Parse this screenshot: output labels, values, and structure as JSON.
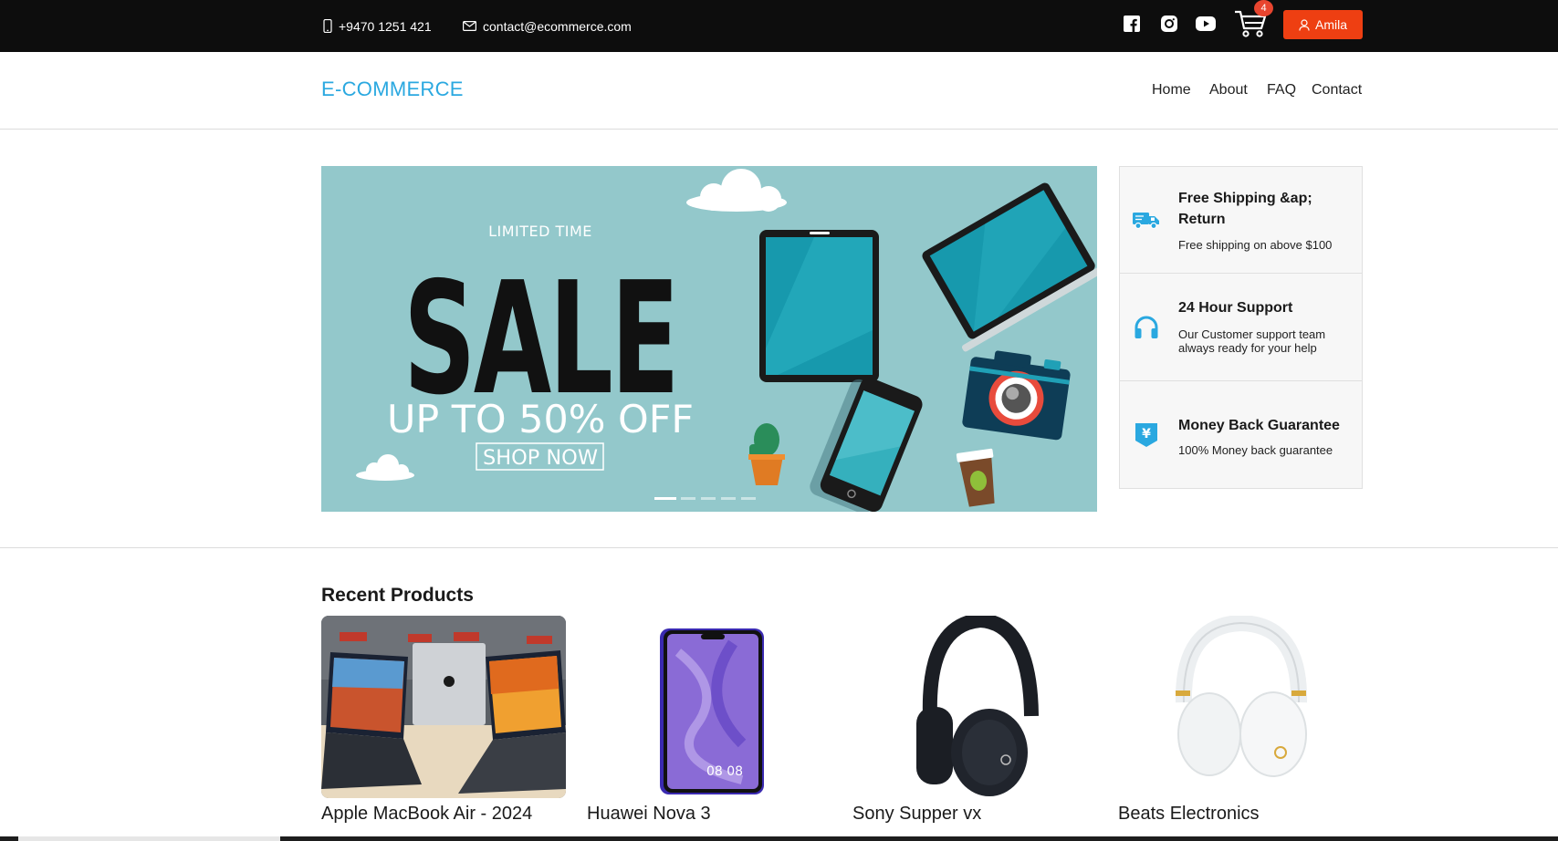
{
  "topbar": {
    "phone": "+9470 1251 421",
    "email": "contact@ecommerce.com",
    "social": [
      "facebook-icon",
      "instagram-icon",
      "youtube-icon"
    ],
    "cart_count": "4",
    "user_name": "Amila"
  },
  "nav": {
    "brand": "E-COMMERCE",
    "links": [
      "Home",
      "About",
      "FAQ",
      "Contact"
    ]
  },
  "banner": {
    "line1": "LIMITED TIME",
    "line2": "SALE",
    "line3": "UP TO 50% OFF",
    "cta": "SHOP NOW",
    "slides": 5,
    "active_slide": 1
  },
  "features": [
    {
      "icon": "truck-icon",
      "title": "Free Shipping &ap; Return",
      "desc": "Free shipping on above $100"
    },
    {
      "icon": "headphones-icon",
      "title": "24 Hour Support",
      "desc": "Our Customer support team always ready for your help"
    },
    {
      "icon": "money-back-icon",
      "title": "Money Back Guarantee",
      "desc": "100% Money back guarantee"
    }
  ],
  "recent": {
    "title": "Recent Products",
    "products": [
      {
        "name": "Apple MacBook Air - 2024"
      },
      {
        "name": "Huawei Nova 3"
      },
      {
        "name": "Sony Supper vx"
      },
      {
        "name": "Beats Electronics"
      }
    ]
  },
  "colors": {
    "accent": "#2aa8e0",
    "button": "#ee3f12",
    "topbar": "#0d0d0d"
  }
}
